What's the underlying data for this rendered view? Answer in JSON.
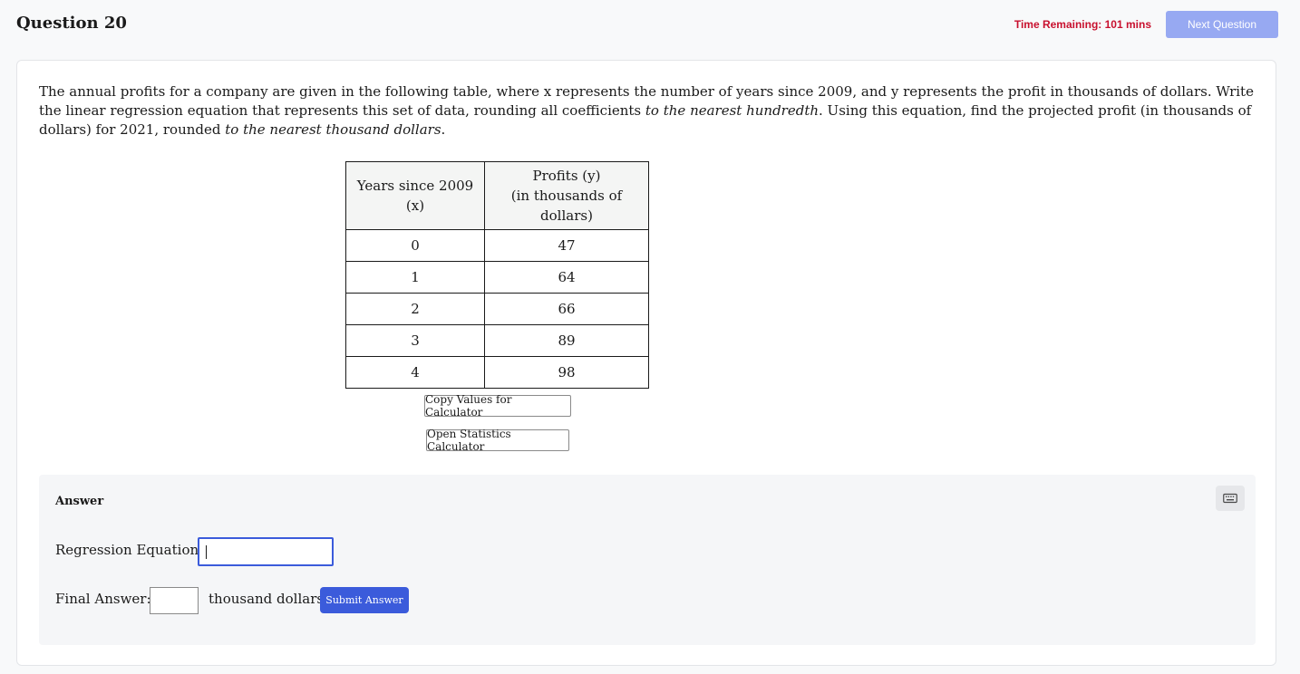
{
  "header": {
    "title": "Question 20",
    "timer": "Time Remaining: 101 mins",
    "next_label": "Next Question"
  },
  "question": {
    "part1": "The annual profits for a company are given in the following table, where x represents the number of years since 2009, and y represents the profit in thousands of dollars. Write the linear regression equation that represents this set of data, rounding all coefficients ",
    "em1": "to the nearest hundredth",
    "part2": ". Using this equation, find the projected profit (in thousands of dollars) for 2021, rounded ",
    "em2": "to the nearest thousand dollars",
    "part3": "."
  },
  "table": {
    "header_x": "Years since 2009 (x)",
    "header_y_line1": "Profits (y)",
    "header_y_line2": "(in thousands of dollars)",
    "rows": [
      {
        "x": "0",
        "y": "47"
      },
      {
        "x": "1",
        "y": "64"
      },
      {
        "x": "2",
        "y": "66"
      },
      {
        "x": "3",
        "y": "89"
      },
      {
        "x": "4",
        "y": "98"
      }
    ]
  },
  "tools": {
    "copy_label": "Copy Values for Calculator",
    "open_label": "Open Statistics Calculator"
  },
  "answer": {
    "heading": "Answer",
    "keyboard_icon": "keyboard-icon",
    "regression_label": "Regression Equation:",
    "regression_value": "",
    "final_label": "Final Answer:",
    "final_value": "",
    "unit_label": "thousand dollars",
    "submit_label": "Submit Answer"
  },
  "colors": {
    "accent": "#3b5bdb",
    "timer": "#c8102e",
    "next_disabled": "#97a9f2"
  }
}
